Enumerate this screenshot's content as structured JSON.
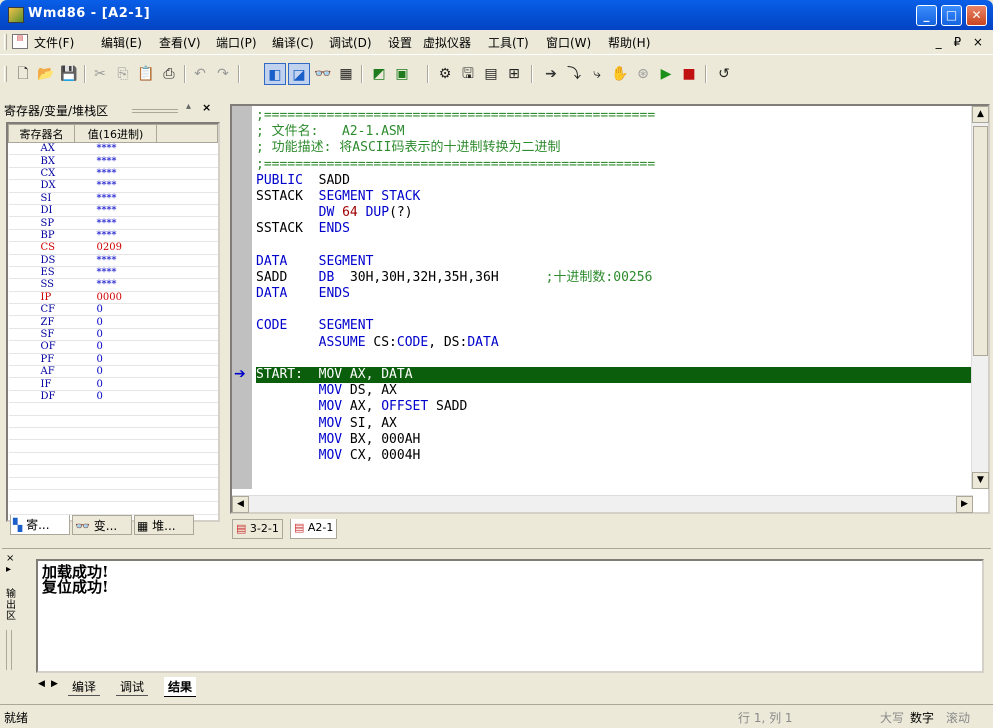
{
  "window": {
    "title": "Wmd86 - [A2-1]",
    "min": "_",
    "max": "□",
    "close": "✕"
  },
  "menubar": {
    "items": [
      "文件(F)",
      "编辑(E)",
      "查看(V)",
      "端口(P)",
      "编译(C)",
      "调试(D)",
      "设置",
      "虚拟仪器",
      "工具(T)",
      "窗口(W)",
      "帮助(H)"
    ],
    "mdi": "_ ₽ ×"
  },
  "toolbar": {
    "new": "🗋",
    "open": "📂",
    "save": "💾",
    "cut": "✂",
    "copy": "⎘",
    "paste": "📋",
    "print": "⎙",
    "undo": "↶",
    "redo": "↷",
    "compile": "◧",
    "link": "◪",
    "watch": "👓",
    "mem": "▦",
    "build": "◩",
    "run": "▣",
    "step": "⚙",
    "disk": "🖫",
    "regs": "▤",
    "view": "⊞",
    "goto": "➔",
    "stepin": "⤵",
    "stepover": "⤷",
    "hand": "✋",
    "bp": "⊛",
    "runbtn": "▶",
    "stop": "■",
    "reset": "↺"
  },
  "left_panel": {
    "title": "寄存器/变量/堆栈区",
    "col_name": "寄存器名",
    "col_value": "值(16进制)",
    "rows": [
      {
        "name": "AX",
        "value": "****",
        "red": false
      },
      {
        "name": "BX",
        "value": "****",
        "red": false
      },
      {
        "name": "CX",
        "value": "****",
        "red": false
      },
      {
        "name": "DX",
        "value": "****",
        "red": false
      },
      {
        "name": "SI",
        "value": "****",
        "red": false
      },
      {
        "name": "DI",
        "value": "****",
        "red": false
      },
      {
        "name": "SP",
        "value": "****",
        "red": false
      },
      {
        "name": "BP",
        "value": "****",
        "red": false
      },
      {
        "name": "CS",
        "value": "0209",
        "red": true
      },
      {
        "name": "DS",
        "value": "****",
        "red": false
      },
      {
        "name": "ES",
        "value": "****",
        "red": false
      },
      {
        "name": "SS",
        "value": "****",
        "red": false
      },
      {
        "name": "IP",
        "value": "0000",
        "red": true
      },
      {
        "name": "CF",
        "value": "0",
        "red": false
      },
      {
        "name": "ZF",
        "value": "0",
        "red": false
      },
      {
        "name": "SF",
        "value": "0",
        "red": false
      },
      {
        "name": "OF",
        "value": "0",
        "red": false
      },
      {
        "name": "PF",
        "value": "0",
        "red": false
      },
      {
        "name": "AF",
        "value": "0",
        "red": false
      },
      {
        "name": "IF",
        "value": "0",
        "red": false
      },
      {
        "name": "DF",
        "value": "0",
        "red": false
      }
    ],
    "tabs": [
      "寄...",
      "变...",
      "堆..."
    ]
  },
  "editor": {
    "lines": [
      {
        "parts": [
          {
            "t": ";==================================================",
            "c": "cm"
          }
        ]
      },
      {
        "parts": [
          {
            "t": "; 文件名:   A2-1.ASM",
            "c": "cm"
          }
        ]
      },
      {
        "parts": [
          {
            "t": "; 功能描述: 将ASCII码表示的十进制转换为二进制",
            "c": "cm"
          }
        ]
      },
      {
        "parts": [
          {
            "t": ";==================================================",
            "c": "cm"
          }
        ]
      },
      {
        "parts": [
          {
            "t": "PUBLIC  ",
            "c": "kw"
          },
          {
            "t": "SADD",
            "c": "op"
          }
        ]
      },
      {
        "parts": [
          {
            "t": "SSTACK  ",
            "c": "op"
          },
          {
            "t": "SEGMENT STACK",
            "c": "kw"
          }
        ]
      },
      {
        "parts": [
          {
            "t": "        DW ",
            "c": "kw"
          },
          {
            "t": "64",
            "c": "num"
          },
          {
            "t": " DUP",
            "c": "kw"
          },
          {
            "t": "(?)",
            "c": "op"
          }
        ]
      },
      {
        "parts": [
          {
            "t": "SSTACK  ",
            "c": "op"
          },
          {
            "t": "ENDS",
            "c": "kw"
          }
        ]
      },
      {
        "parts": [
          {
            "t": "",
            "c": "op"
          }
        ]
      },
      {
        "parts": [
          {
            "t": "DATA    ",
            "c": "kw"
          },
          {
            "t": "SEGMENT",
            "c": "kw"
          }
        ]
      },
      {
        "parts": [
          {
            "t": "SADD    ",
            "c": "op"
          },
          {
            "t": "DB  ",
            "c": "kw"
          },
          {
            "t": "30H,30H,32H,35H,36H      ",
            "c": "op"
          },
          {
            "t": ";十进制数:00256",
            "c": "cm"
          }
        ]
      },
      {
        "parts": [
          {
            "t": "DATA    ",
            "c": "kw"
          },
          {
            "t": "ENDS",
            "c": "kw"
          }
        ]
      },
      {
        "parts": [
          {
            "t": "",
            "c": "op"
          }
        ]
      },
      {
        "parts": [
          {
            "t": "CODE    ",
            "c": "kw"
          },
          {
            "t": "SEGMENT",
            "c": "kw"
          }
        ]
      },
      {
        "parts": [
          {
            "t": "        ASSUME ",
            "c": "kw"
          },
          {
            "t": "CS:",
            "c": "op"
          },
          {
            "t": "CODE",
            "c": "kw"
          },
          {
            "t": ", DS:",
            "c": "op"
          },
          {
            "t": "DATA",
            "c": "kw"
          }
        ]
      },
      {
        "parts": [
          {
            "t": "",
            "c": "op"
          }
        ]
      },
      {
        "parts": [
          {
            "t": "START:  MOV AX, DATA",
            "c": "hl"
          }
        ],
        "current": true
      },
      {
        "parts": [
          {
            "t": "        MOV ",
            "c": "kw"
          },
          {
            "t": "DS, AX",
            "c": "op"
          }
        ]
      },
      {
        "parts": [
          {
            "t": "        MOV ",
            "c": "kw"
          },
          {
            "t": "AX, ",
            "c": "op"
          },
          {
            "t": "OFFSET ",
            "c": "kw"
          },
          {
            "t": "SADD",
            "c": "op"
          }
        ]
      },
      {
        "parts": [
          {
            "t": "        MOV ",
            "c": "kw"
          },
          {
            "t": "SI, AX",
            "c": "op"
          }
        ]
      },
      {
        "parts": [
          {
            "t": "        MOV ",
            "c": "kw"
          },
          {
            "t": "BX, 000AH",
            "c": "op"
          }
        ]
      },
      {
        "parts": [
          {
            "t": "        MOV ",
            "c": "kw"
          },
          {
            "t": "CX, 0004H",
            "c": "op"
          }
        ]
      }
    ],
    "tabs": [
      "3-2-1",
      "A2-1"
    ],
    "arrow": "➔"
  },
  "output": {
    "lines": [
      "加载成功!",
      "复位成功!"
    ],
    "side_label": "输出区",
    "tabs": [
      "编译",
      "调试",
      "结果"
    ]
  },
  "status": {
    "ready": "就绪",
    "pos": "行 1, 列 1",
    "caps": "大写",
    "num": "数字",
    "scroll": "滚动"
  },
  "colors": {
    "titlebar": "#0553d8",
    "current_line": "#0b5e0b",
    "keyword": "#0000cc",
    "comment": "#2e8b2e"
  }
}
